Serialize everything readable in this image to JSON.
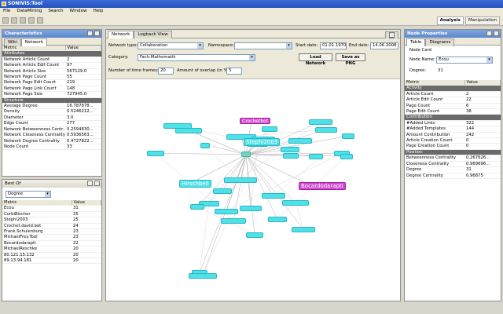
{
  "window": {
    "title": "SONIVIS:Tool"
  },
  "menu": [
    "File",
    "DataMining",
    "Search",
    "Window",
    "Help"
  ],
  "perspectives": [
    "Analysis",
    "Manipulation"
  ],
  "characteristics": {
    "title": "Characteristics",
    "tabs": [
      "Wiki",
      "Network"
    ],
    "headers": [
      "Metric",
      "Value"
    ],
    "sections": [
      {
        "name": "Attributes",
        "rows": [
          [
            "Network Article Count",
            "2"
          ],
          [
            "Network Article Edit Count",
            "97"
          ],
          [
            "Network Article Size",
            "567129.0"
          ],
          [
            "Network Page Count",
            "55"
          ],
          [
            "Network Page Edit Count",
            "219"
          ],
          [
            "Network Page Link Count",
            "148"
          ],
          [
            "Network Page Size",
            "727945.0"
          ]
        ]
      },
      {
        "name": "Structure",
        "rows": [
          [
            "Average Degree",
            "16.787878..."
          ],
          [
            "Density",
            "0.5246212..."
          ],
          [
            "Diameter",
            "3.0"
          ],
          [
            "Edge Count",
            "277"
          ],
          [
            "Network Betweenness Centr...",
            "0.2594830..."
          ],
          [
            "Network Closeness Centrality",
            "0.5936563..."
          ],
          [
            "Network Degree Centrality",
            "0.4727822..."
          ],
          [
            "Node Count",
            "33"
          ]
        ]
      }
    ]
  },
  "bestof": {
    "title": "Best Of",
    "selected": "Degree",
    "headers": [
      "Metric",
      "Value"
    ],
    "rows": [
      [
        "Ecou",
        "31"
      ],
      [
        "CorbiBischer",
        "25"
      ],
      [
        "Stephi2003",
        "25"
      ],
      [
        "Crochet.david.bot",
        "24"
      ],
      [
        "Frank.Schulenburg",
        "23"
      ],
      [
        "MichaelFrey.Tool",
        "23"
      ],
      [
        "Bocardodarapti",
        "22"
      ],
      [
        "MichaelReschke",
        "20"
      ],
      [
        "80.121.15.132",
        "20"
      ],
      [
        "89.13.94.181",
        "20"
      ]
    ]
  },
  "editor": {
    "tabs": [
      "Network",
      "Logback View"
    ],
    "network_type_label": "Network type:",
    "network_type": "Collaboration",
    "namespace_label": "Namespace:",
    "namespace": "",
    "start_label": "Start date:",
    "start": "01.01.1970",
    "end_label": "End date:",
    "end": "14.06.2008",
    "category_label": "Category:",
    "category": "Fach:Mathematik",
    "load_btn": "Load Network",
    "save_btn": "Save as PNG",
    "frames_label": "Number of time frames:",
    "frames": "20",
    "overlap_label": "Amount of overlap (in %):",
    "overlap": "5"
  },
  "graph": {
    "center": "Stephi2003",
    "colors": {
      "node": "#4fe0e8",
      "highlight": "#d04bd0",
      "edge": "#b0b0b0"
    },
    "nodes": [
      {
        "label": "Stephi2003",
        "size": "big",
        "hl": false
      },
      {
        "label": "Hirschbell",
        "size": "big",
        "hl": false
      },
      {
        "label": "Bocardodarapti",
        "size": "big",
        "hl": true
      },
      {
        "label": "Crochetbot",
        "size": "mid",
        "hl": true
      },
      {
        "label": "",
        "size": "small",
        "hl": false
      }
    ]
  },
  "nodeprops": {
    "title": "Node Properties",
    "tabs": [
      "Table",
      "Diagrams"
    ],
    "card_label": "Node Card",
    "name_label": "Node Name:",
    "name": "Ecou",
    "degree_label": "Degree:",
    "degree": "31",
    "headers": [
      "Metric",
      "Value"
    ],
    "sections": [
      {
        "name": "Activity",
        "rows": [
          [
            "Article Count",
            "2"
          ],
          [
            "Article Edit Count",
            "22"
          ],
          [
            "Page Count",
            "6"
          ],
          [
            "Page Edit Count",
            "38"
          ]
        ]
      },
      {
        "name": "Contribution",
        "rows": [
          [
            "#Added Links",
            "322"
          ],
          [
            "#Added Templates",
            "144"
          ],
          [
            "Amount Contribution",
            "242"
          ],
          [
            "Article Creation Count",
            "0"
          ],
          [
            "Page Creation Count",
            "0"
          ]
        ]
      },
      {
        "name": "Position",
        "rows": [
          [
            "Betweenness Centrality",
            "0.267626..."
          ],
          [
            "Closeness Centrality",
            "0.969696..."
          ],
          [
            "Degree",
            "31"
          ],
          [
            "Degree Centrality",
            "0.96875"
          ]
        ]
      }
    ]
  }
}
